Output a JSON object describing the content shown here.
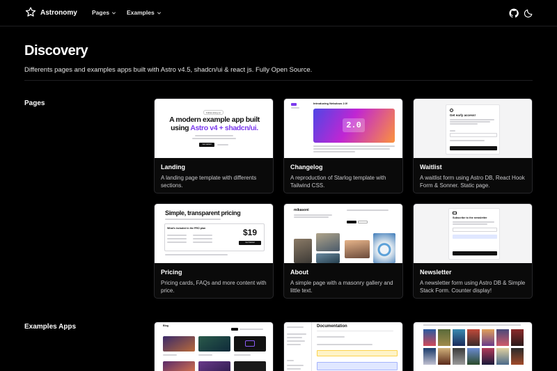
{
  "header": {
    "brand": "Astronomy",
    "nav": [
      {
        "label": "Pages"
      },
      {
        "label": "Examples"
      }
    ],
    "icons": [
      "github-icon",
      "moon-icon"
    ]
  },
  "hero": {
    "title": "Discovery",
    "subtitle": "Differents pages and examples apps built with Astro v4.5, shadcn/ui & react js. Fully Open Source."
  },
  "sections": {
    "pages_label": "Pages",
    "examples_label": "Examples Apps"
  },
  "pages": [
    {
      "title": "Landing",
      "desc": "A landing page template with differents sections.",
      "thumb": {
        "badge": "Follow along on",
        "headline_1": "A modern example app built",
        "headline_2a": "using ",
        "headline_2b": "Astro v4 + shadcn/ui.",
        "button": "Get started"
      }
    },
    {
      "title": "Changelog",
      "desc": "A reproduction of Starlog template with Tailwind CSS.",
      "thumb": {
        "heading": "Introducing Nebulous 2.0!",
        "version": "2.0"
      }
    },
    {
      "title": "Waitlist",
      "desc": "A waitlist form using Astro DB, React Hook Form & Sonner. Static page.",
      "thumb": {
        "heading": "Get early access!"
      }
    },
    {
      "title": "Pricing",
      "desc": "Pricing cards, FAQs and more content with price.",
      "thumb": {
        "heading": "Simple, transparent pricing",
        "plan": "What's included in the PRO plan",
        "price": "$19",
        "button": "Get Started"
      }
    },
    {
      "title": "About",
      "desc": "A simple page with a masonry gallery and little text.",
      "thumb": {
        "logo": "mikasoni"
      }
    },
    {
      "title": "Newsletter",
      "desc": "A newsletter form using Astro DB & Simple Stack Form. Counter display!",
      "thumb": {
        "heading": "Subscribe to the newsletter"
      }
    }
  ],
  "examples": [
    {
      "thumb": {
        "heading": "Blog"
      }
    },
    {
      "thumb": {
        "heading": "Documentation"
      }
    },
    {
      "thumb": {}
    }
  ],
  "colors": {
    "background": "#000000",
    "card_border": "#27272a",
    "accent_purple": "#7c3aed",
    "changelog_gradient": [
      "#4f46e5",
      "#c026d3",
      "#fb923c"
    ]
  }
}
